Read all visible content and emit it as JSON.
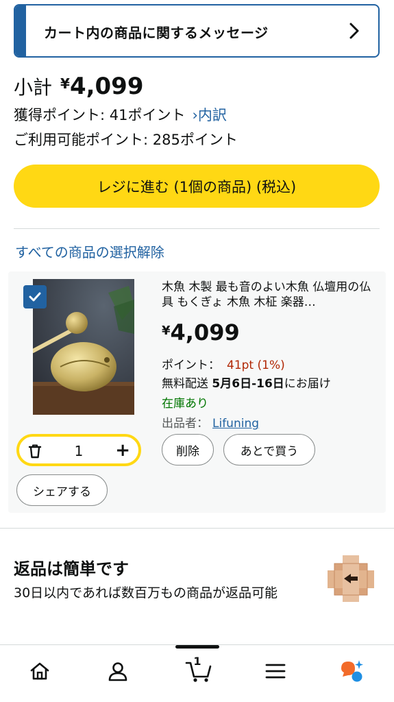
{
  "cart_message": {
    "label": "カート内の商品に関するメッセージ"
  },
  "summary": {
    "subtotal_label": "小計",
    "currency": "¥",
    "subtotal_amount": "4,099",
    "points_earned": "獲得ポイント: 41ポイント",
    "breakdown_link": "›内訳",
    "points_available": "ご利用可能ポイント: 285ポイント"
  },
  "checkout_button": {
    "label": "レジに進む (1個の商品) (税込)"
  },
  "deselect_all": {
    "label": "すべての商品の選択解除"
  },
  "cart_item": {
    "selected": true,
    "title": "木魚 木製 最も音のよい木魚 仏壇用の仏具 もくぎょ 木魚 木柾 楽器…",
    "currency": "¥",
    "price": "4,099",
    "points_label": "ポイント：",
    "points_value": "41pt (1%)",
    "shipping_prefix": "無料配送",
    "shipping_dates": "5月6日-16日",
    "shipping_suffix": "にお届け",
    "stock": "在庫あり",
    "seller_label": "出品者：",
    "seller_name": "Lifuning",
    "quantity": "1",
    "delete_label": "削除",
    "save_later_label": "あとで買う",
    "share_label": "シェアする"
  },
  "returns": {
    "title": "返品は簡単です",
    "subtitle": "30日以内であれば数百万もの商品が返品可能"
  },
  "bottom_nav": {
    "items": [
      "home-icon",
      "account-icon",
      "cart-icon",
      "menu-icon",
      "assistant-icon"
    ],
    "cart_count": "1"
  },
  "colors": {
    "accent_blue": "#2162a1",
    "checkout_yellow": "#ffd814",
    "price_red": "#b12704",
    "stock_green": "#007600"
  }
}
